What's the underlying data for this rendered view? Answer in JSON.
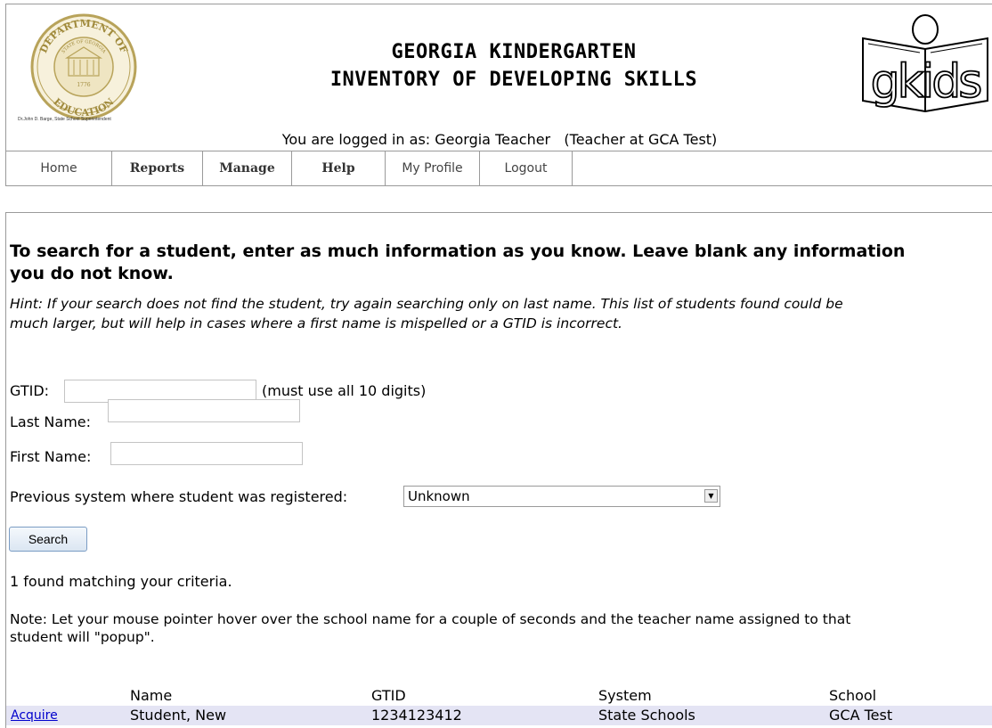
{
  "header": {
    "title_line1": "GEORGIA KINDERGARTEN",
    "title_line2": "INVENTORY OF DEVELOPING SKILLS",
    "seal_text_top": "DEPARTMENT OF",
    "seal_text_bottom": "EDUCATION",
    "seal_inner": "STATE OF GEORGIA",
    "seal_year": "1776",
    "superintendent": "Dr.John D. Barge, State School Superintendent",
    "logo_text": "gkids",
    "login_line": "You are logged in as: Georgia Teacher   (Teacher at GCA Test)"
  },
  "nav": [
    {
      "label": "Home",
      "bold": false
    },
    {
      "label": "Reports",
      "bold": true
    },
    {
      "label": "Manage",
      "bold": true
    },
    {
      "label": "Help",
      "bold": true
    },
    {
      "label": "My Profile",
      "bold": false
    },
    {
      "label": "Logout",
      "bold": false
    }
  ],
  "search": {
    "heading": "To search for a student, enter as much information as you know. Leave blank any information you do not know.",
    "hint_line1": "Hint: If your search does not find the student, try again searching only on last name. This list of students found could be",
    "hint_line2": "much larger, but will help in cases where a first name is mispelled or a GTID is incorrect.",
    "gtid_label": "GTID:",
    "gtid_value": "",
    "gtid_note": "(must use all 10 digits)",
    "last_name_label": "Last Name:",
    "last_name_value": "",
    "first_name_label": "First Name:",
    "first_name_value": "",
    "previous_system_label": "Previous system where student was registered:",
    "previous_system_value": "Unknown",
    "search_button": "Search"
  },
  "results": {
    "found_text": "1 found matching your criteria.",
    "note_line1": "Note: Let your mouse pointer hover over the school name for a couple of seconds and the teacher name assigned to that",
    "note_line2": "student will \"popup\".",
    "columns": [
      "Name",
      "GTID",
      "System",
      "School"
    ],
    "rows": [
      {
        "action": "Acquire",
        "name": "Student, New",
        "gtid": "1234123412",
        "system": "State Schools",
        "school": "GCA Test"
      }
    ]
  }
}
